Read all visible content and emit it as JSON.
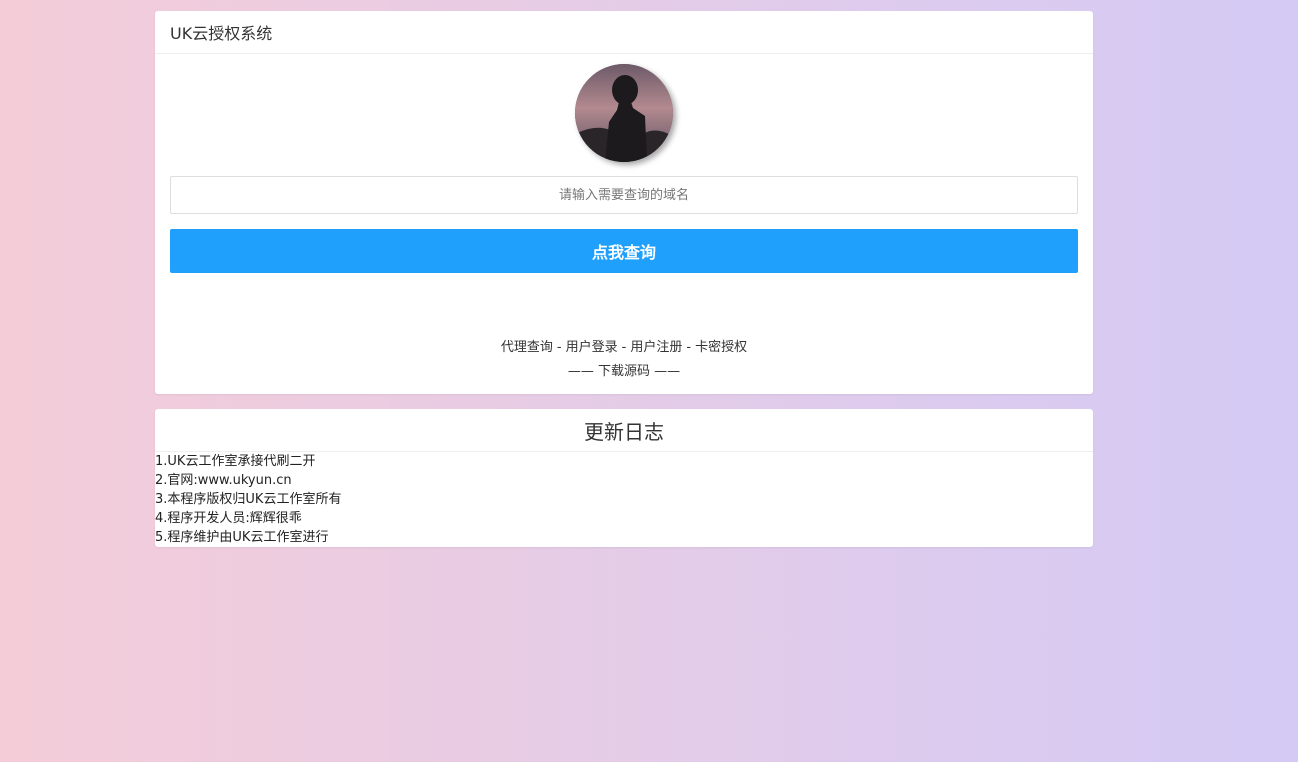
{
  "main_panel": {
    "title": "UK云授权系统",
    "search": {
      "placeholder": "请输入需要查询的域名",
      "value": ""
    },
    "query_button": "点我查询",
    "links": [
      "代理查询",
      "用户登录",
      "用户注册",
      "卡密授权"
    ],
    "link_separator": "-",
    "download_prefix": "——",
    "download_label": "下载源码",
    "download_suffix": "——"
  },
  "log_panel": {
    "title": "更新日志",
    "items": [
      "1.UK云工作室承接代刷二开",
      "2.官网:www.ukyun.cn",
      "3.本程序版权归UK云工作室所有",
      "4.程序开发人员:辉辉很乖",
      "5.程序维护由UK云工作室进行"
    ]
  },
  "colors": {
    "accent": "#1fa0fd",
    "background_start": "#f4ccd8",
    "background_end": "#d4caf4"
  },
  "icons": {
    "avatar": "avatar-silhouette"
  }
}
